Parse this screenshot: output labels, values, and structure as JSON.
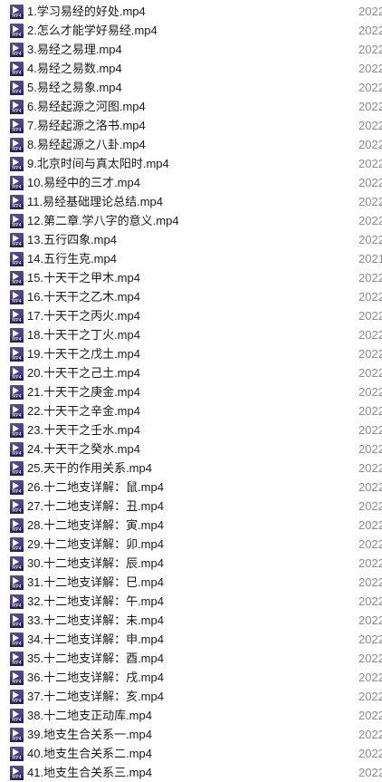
{
  "files": [
    {
      "name": "1.学习易经的好处.mp4",
      "date": "2022",
      "icon": "mp4-video-icon"
    },
    {
      "name": "2.怎么才能学好易经.mp4",
      "date": "2022",
      "icon": "mp4-video-icon"
    },
    {
      "name": "3.易经之易理.mp4",
      "date": "2022",
      "icon": "mp4-video-icon"
    },
    {
      "name": "4.易经之易数.mp4",
      "date": "2022",
      "icon": "mp4-video-icon"
    },
    {
      "name": "5.易经之易象.mp4",
      "date": "2022",
      "icon": "mp4-video-icon"
    },
    {
      "name": "6.易经起源之河图.mp4",
      "date": "2022",
      "icon": "mp4-video-icon"
    },
    {
      "name": "7.易经起源之洛书.mp4",
      "date": "2022",
      "icon": "mp4-video-icon"
    },
    {
      "name": "8.易经起源之八卦.mp4",
      "date": "2022",
      "icon": "mp4-video-icon"
    },
    {
      "name": "9.北京时间与真太阳时.mp4",
      "date": "2022",
      "icon": "mp4-video-icon"
    },
    {
      "name": "10.易经中的三才.mp4",
      "date": "2022",
      "icon": "mp4-video-icon"
    },
    {
      "name": "11.易经基础理论总结.mp4",
      "date": "2022",
      "icon": "mp4-video-icon"
    },
    {
      "name": "12.第二章.学八字的意义.mp4",
      "date": "2022",
      "icon": "mp4-video-icon"
    },
    {
      "name": "13.五行四象.mp4",
      "date": "2022",
      "icon": "mp4-video-icon"
    },
    {
      "name": "14.五行生克.mp4",
      "date": "2021",
      "icon": "mp4-video-icon"
    },
    {
      "name": "15.十天干之甲木.mp4",
      "date": "2022",
      "icon": "mp4-video-icon"
    },
    {
      "name": "16.十天干之乙木.mp4",
      "date": "2022",
      "icon": "mp4-video-icon"
    },
    {
      "name": "17.十天干之丙火.mp4",
      "date": "2022",
      "icon": "mp4-video-icon"
    },
    {
      "name": "18.十天干之丁火.mp4",
      "date": "2022",
      "icon": "mp4-video-icon"
    },
    {
      "name": "19.十天干之戊土.mp4",
      "date": "2022",
      "icon": "mp4-video-icon"
    },
    {
      "name": "20.十天干之己土.mp4",
      "date": "2022",
      "icon": "mp4-video-icon"
    },
    {
      "name": "21.十天干之庚金.mp4",
      "date": "2022",
      "icon": "mp4-video-icon"
    },
    {
      "name": "22.十天干之辛金.mp4",
      "date": "2022",
      "icon": "mp4-video-icon"
    },
    {
      "name": "23.十天干之壬水.mp4",
      "date": "2022",
      "icon": "mp4-video-icon"
    },
    {
      "name": "24.十天干之癸水.mp4",
      "date": "2022",
      "icon": "mp4-video-icon"
    },
    {
      "name": "25.天干的作用关系.mp4",
      "date": "2022",
      "icon": "mp4-video-icon"
    },
    {
      "name": "26.十二地支详解：鼠.mp4",
      "date": "2022",
      "icon": "mp4-video-icon"
    },
    {
      "name": "27.十二地支详解：丑.mp4",
      "date": "2022",
      "icon": "mp4-video-icon"
    },
    {
      "name": "28.十二地支详解：寅.mp4",
      "date": "2022",
      "icon": "mp4-video-icon"
    },
    {
      "name": "29.十二地支详解：卯.mp4",
      "date": "2022",
      "icon": "mp4-video-icon"
    },
    {
      "name": "30.十二地支详解：辰.mp4",
      "date": "2022",
      "icon": "mp4-video-icon"
    },
    {
      "name": "31.十二地支详解：巳.mp4",
      "date": "2022",
      "icon": "mp4-video-icon"
    },
    {
      "name": "32.十二地支详解：午.mp4",
      "date": "2022",
      "icon": "mp4-video-icon"
    },
    {
      "name": "33.十二地支详解：未.mp4",
      "date": "2022",
      "icon": "mp4-video-icon"
    },
    {
      "name": "34.十二地支详解：申.mp4",
      "date": "2022",
      "icon": "mp4-video-icon"
    },
    {
      "name": "35.十二地支详解：酉.mp4",
      "date": "2022",
      "icon": "mp4-video-icon"
    },
    {
      "name": "36.十二地支详解：戌.mp4",
      "date": "2022",
      "icon": "mp4-video-icon"
    },
    {
      "name": "37.十二地支详解：亥.mp4",
      "date": "2022",
      "icon": "mp4-video-icon"
    },
    {
      "name": "38.十二地支正动库.mp4",
      "date": "2022",
      "icon": "mp4-video-icon"
    },
    {
      "name": "39.地支生合关系一.mp4",
      "date": "2022",
      "icon": "mp4-video-icon"
    },
    {
      "name": "40.地支生合关系二.mp4",
      "date": "2022",
      "icon": "mp4-video-icon"
    },
    {
      "name": "41.地支生合关系三.mp4",
      "date": "2022",
      "icon": "mp4-video-icon"
    }
  ],
  "colors": {
    "background": "#ffffff",
    "filename_text": "#1a1a1a",
    "date_text": "#8c8c8c",
    "icon_purple": "#4a3b7c"
  }
}
